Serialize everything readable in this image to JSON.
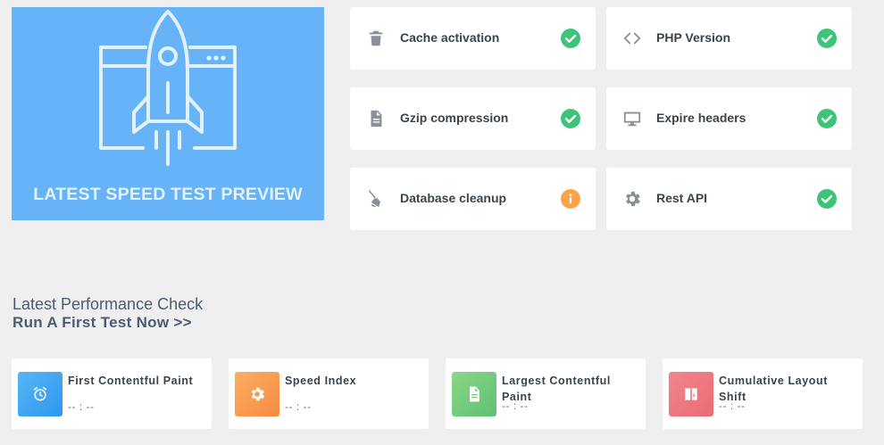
{
  "preview": {
    "caption": "LATEST SPEED TEST PREVIEW",
    "illustration": "rocket-launch-illustration"
  },
  "checks": [
    {
      "label": "Cache activation",
      "icon": "trash-icon",
      "status": "ok"
    },
    {
      "label": "PHP Version",
      "icon": "code-icon",
      "status": "ok"
    },
    {
      "label": "Gzip compression",
      "icon": "document-icon",
      "status": "ok"
    },
    {
      "label": "Expire headers",
      "icon": "monitor-icon",
      "status": "ok"
    },
    {
      "label": "Database cleanup",
      "icon": "broom-icon",
      "status": "warning"
    },
    {
      "label": "Rest API",
      "icon": "gear-icon",
      "status": "ok"
    }
  ],
  "performance": {
    "title": "Latest Performance Check",
    "link": "Run A First Test Now >>",
    "metrics": [
      {
        "name": "First Contentful Paint",
        "value": "-- : --",
        "icon": "alarm-clock-icon",
        "color": "#3ea7f3"
      },
      {
        "name": "Speed Index",
        "value": "-- : --",
        "icon": "gear-icon",
        "color": "#f99c51"
      },
      {
        "name": "Largest Contentful Paint",
        "value": "-- : --",
        "icon": "document-icon",
        "color": "#78cf7c"
      },
      {
        "name": "Cumulative Layout Shift",
        "value": "-- : --",
        "icon": "layout-shift-icon",
        "color": "#ef7c82"
      }
    ]
  },
  "colors": {
    "ok": "#3ec47a",
    "warning": "#f7a44b",
    "preview_bg": "#66b4f7"
  }
}
